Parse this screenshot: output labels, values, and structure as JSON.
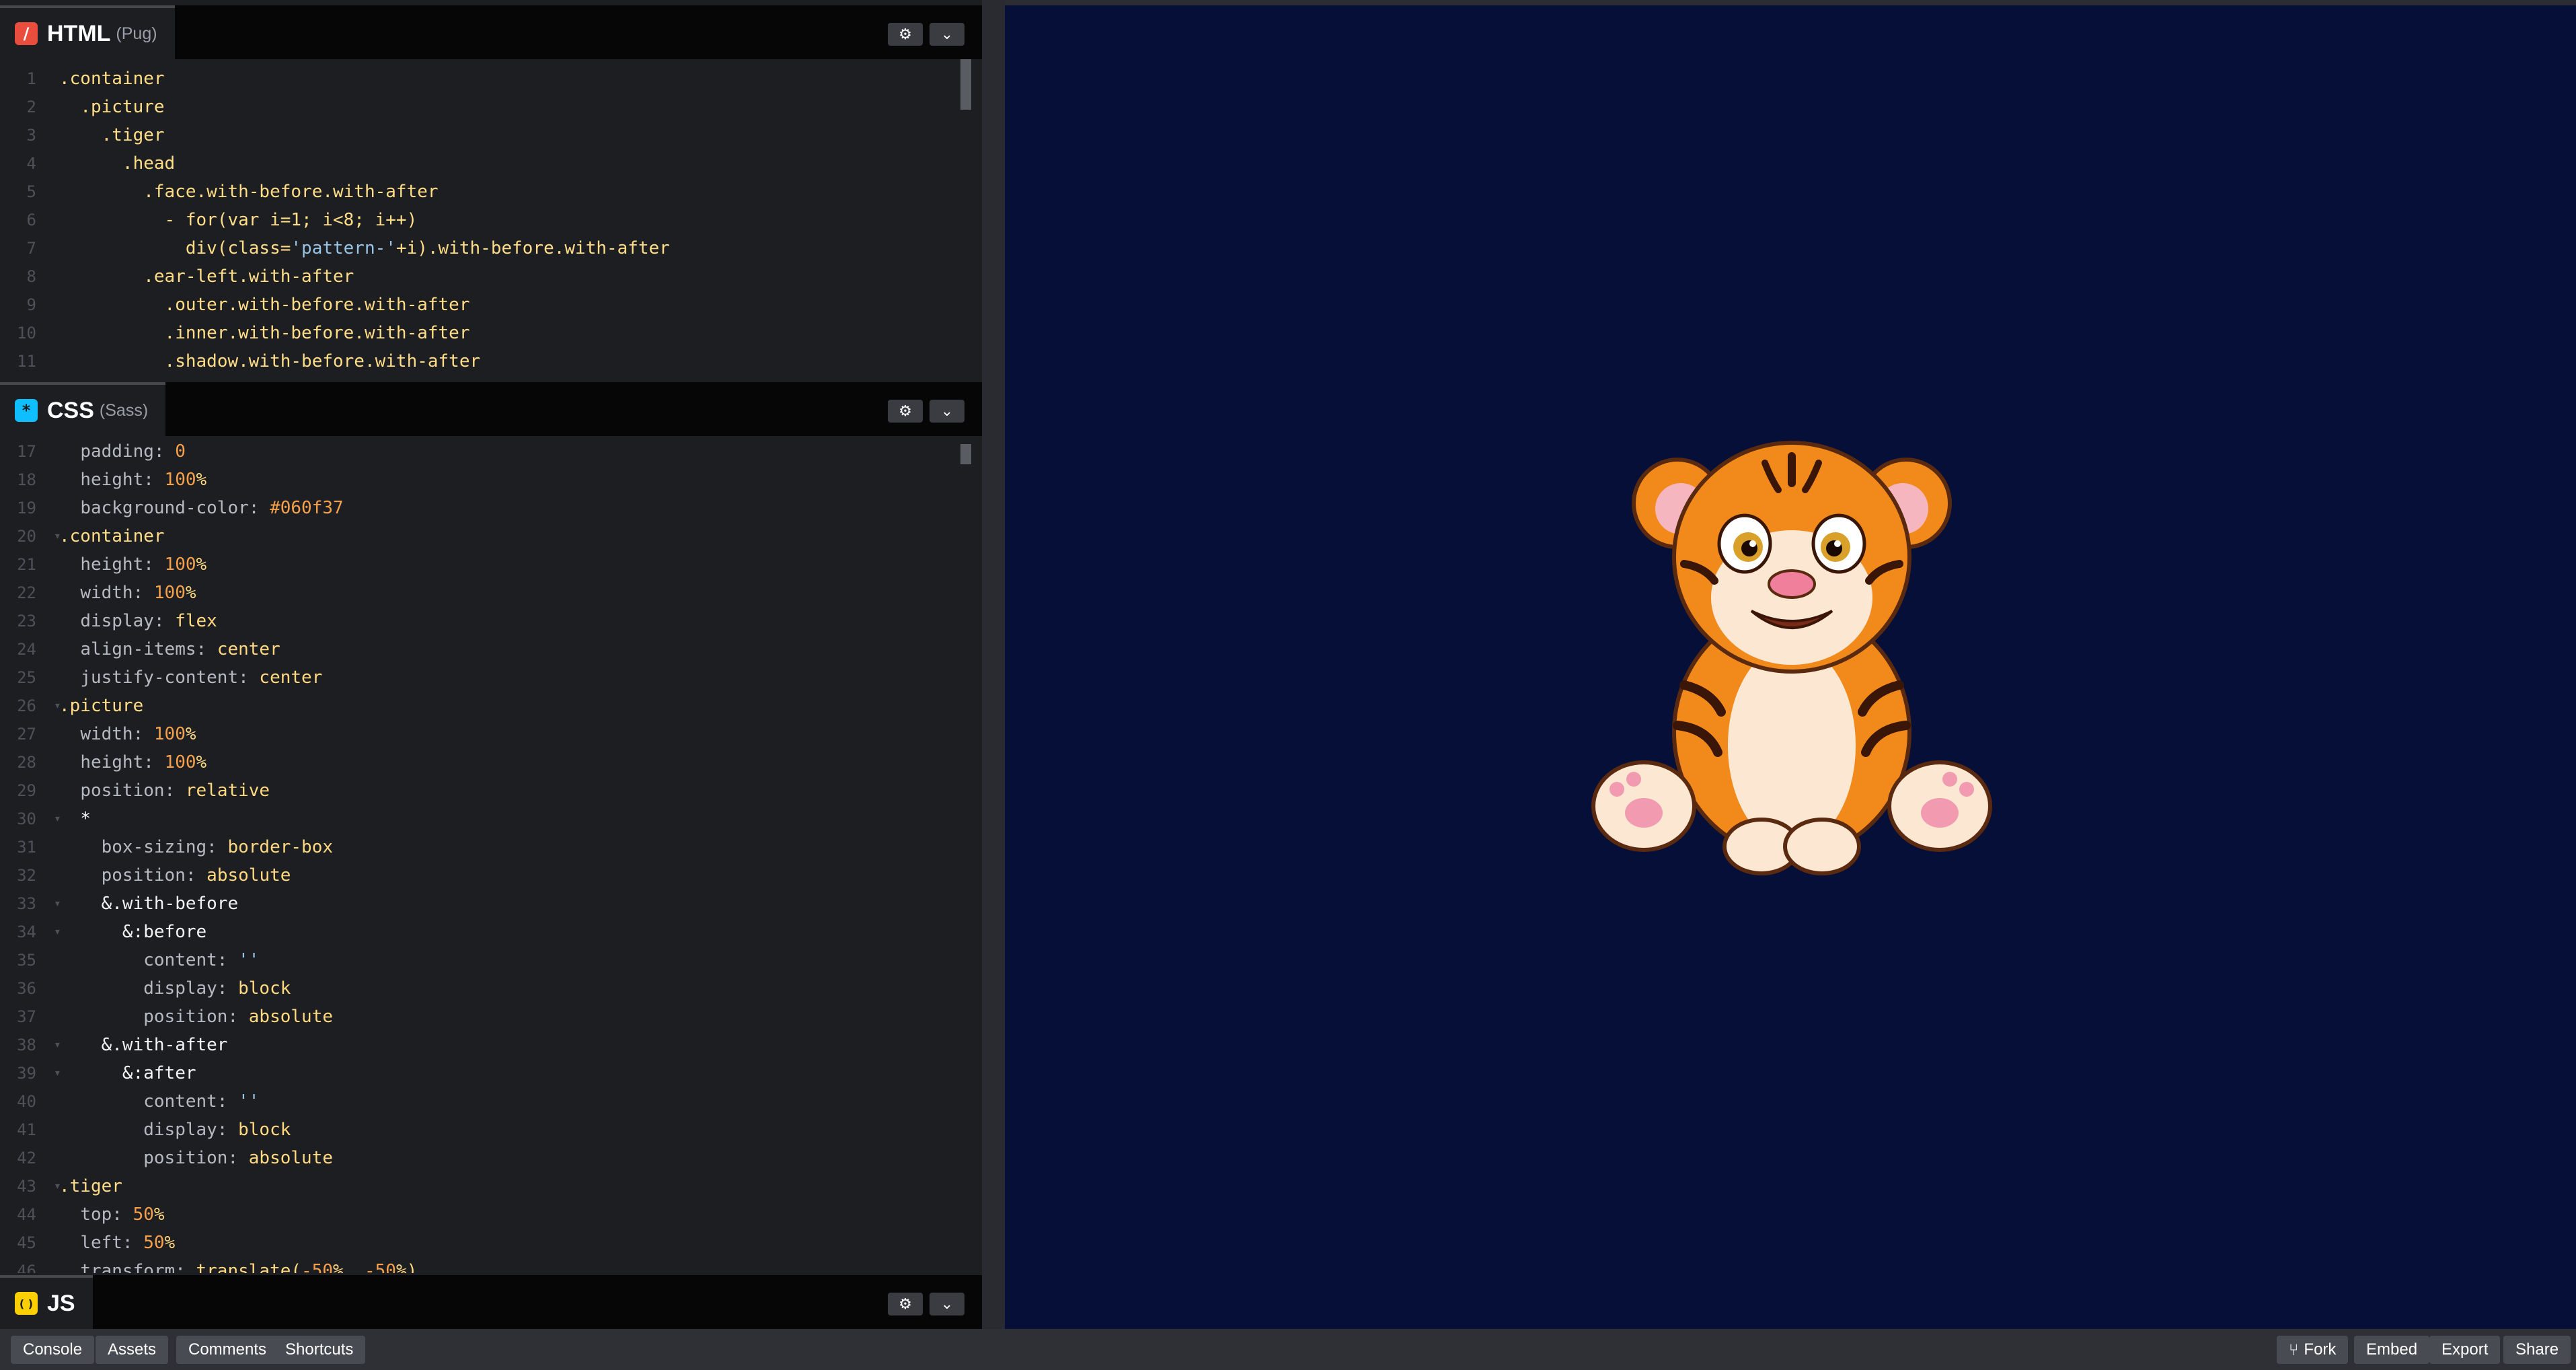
{
  "html_panel": {
    "lang": "HTML",
    "preprocessor": "(Pug)",
    "icon_glyph": "/",
    "icon_color": "#e84d3d",
    "lines": [
      {
        "n": "1",
        "parts": [
          [
            "sel",
            ".container"
          ]
        ]
      },
      {
        "n": "2",
        "parts": [
          [
            "txt",
            "  "
          ],
          [
            "sel",
            ".picture"
          ]
        ]
      },
      {
        "n": "3",
        "parts": [
          [
            "txt",
            "    "
          ],
          [
            "sel",
            ".tiger"
          ]
        ]
      },
      {
        "n": "4",
        "parts": [
          [
            "txt",
            "      "
          ],
          [
            "sel",
            ".head"
          ]
        ]
      },
      {
        "n": "5",
        "parts": [
          [
            "txt",
            "        "
          ],
          [
            "sel",
            ".face.with-before.with-after"
          ]
        ]
      },
      {
        "n": "6",
        "parts": [
          [
            "txt",
            "          "
          ],
          [
            "sel",
            "- for(var i=1; i<8; i++)"
          ]
        ]
      },
      {
        "n": "7",
        "parts": [
          [
            "txt",
            "            "
          ],
          [
            "sel",
            "div("
          ],
          [
            "sel",
            "class="
          ],
          [
            "str",
            "'pattern-'"
          ],
          [
            "sel",
            "+i).with-before.with-after"
          ]
        ]
      },
      {
        "n": "8",
        "parts": [
          [
            "txt",
            "        "
          ],
          [
            "sel",
            ".ear-left.with-after"
          ]
        ]
      },
      {
        "n": "9",
        "parts": [
          [
            "txt",
            "          "
          ],
          [
            "sel",
            ".outer.with-before.with-after"
          ]
        ]
      },
      {
        "n": "10",
        "parts": [
          [
            "txt",
            "          "
          ],
          [
            "sel",
            ".inner.with-before.with-after"
          ]
        ]
      },
      {
        "n": "11",
        "parts": [
          [
            "txt",
            "          "
          ],
          [
            "sel",
            ".shadow.with-before.with-after"
          ]
        ]
      }
    ]
  },
  "css_panel": {
    "lang": "CSS",
    "preprocessor": "(Sass)",
    "icon_glyph": "*",
    "icon_color": "#0ebeff",
    "lines": [
      {
        "n": "17",
        "parts": [
          [
            "txt",
            "  "
          ],
          [
            "prop",
            "padding: "
          ],
          [
            "num",
            "0"
          ]
        ]
      },
      {
        "n": "18",
        "parts": [
          [
            "txt",
            "  "
          ],
          [
            "prop",
            "height: "
          ],
          [
            "num",
            "100"
          ],
          [
            "val",
            "%"
          ]
        ]
      },
      {
        "n": "19",
        "parts": [
          [
            "txt",
            "  "
          ],
          [
            "prop",
            "background-color: "
          ],
          [
            "num",
            "#060f37"
          ]
        ]
      },
      {
        "n": "20",
        "fold": true,
        "parts": [
          [
            "sel",
            ".container"
          ]
        ]
      },
      {
        "n": "21",
        "parts": [
          [
            "txt",
            "  "
          ],
          [
            "prop",
            "height: "
          ],
          [
            "num",
            "100"
          ],
          [
            "val",
            "%"
          ]
        ]
      },
      {
        "n": "22",
        "parts": [
          [
            "txt",
            "  "
          ],
          [
            "prop",
            "width: "
          ],
          [
            "num",
            "100"
          ],
          [
            "val",
            "%"
          ]
        ]
      },
      {
        "n": "23",
        "parts": [
          [
            "txt",
            "  "
          ],
          [
            "prop",
            "display: "
          ],
          [
            "val",
            "flex"
          ]
        ]
      },
      {
        "n": "24",
        "parts": [
          [
            "txt",
            "  "
          ],
          [
            "prop",
            "align-items: "
          ],
          [
            "val",
            "center"
          ]
        ]
      },
      {
        "n": "25",
        "parts": [
          [
            "txt",
            "  "
          ],
          [
            "prop",
            "justify-content: "
          ],
          [
            "val",
            "center"
          ]
        ]
      },
      {
        "n": "26",
        "fold": true,
        "parts": [
          [
            "sel",
            ".picture"
          ]
        ]
      },
      {
        "n": "27",
        "parts": [
          [
            "txt",
            "  "
          ],
          [
            "prop",
            "width: "
          ],
          [
            "num",
            "100"
          ],
          [
            "val",
            "%"
          ]
        ]
      },
      {
        "n": "28",
        "parts": [
          [
            "txt",
            "  "
          ],
          [
            "prop",
            "height: "
          ],
          [
            "num",
            "100"
          ],
          [
            "val",
            "%"
          ]
        ]
      },
      {
        "n": "29",
        "parts": [
          [
            "txt",
            "  "
          ],
          [
            "prop",
            "position: "
          ],
          [
            "val",
            "relative"
          ]
        ]
      },
      {
        "n": "30",
        "fold": true,
        "parts": [
          [
            "txt",
            "  "
          ],
          [
            "kw",
            "*"
          ]
        ]
      },
      {
        "n": "31",
        "parts": [
          [
            "txt",
            "    "
          ],
          [
            "prop",
            "box-sizing: "
          ],
          [
            "val",
            "border-box"
          ]
        ]
      },
      {
        "n": "32",
        "parts": [
          [
            "txt",
            "    "
          ],
          [
            "prop",
            "position: "
          ],
          [
            "val",
            "absolute"
          ]
        ]
      },
      {
        "n": "33",
        "fold": true,
        "parts": [
          [
            "txt",
            "    "
          ],
          [
            "kw",
            "&.with-before"
          ]
        ]
      },
      {
        "n": "34",
        "fold": true,
        "parts": [
          [
            "txt",
            "      "
          ],
          [
            "kw",
            "&:before"
          ]
        ]
      },
      {
        "n": "35",
        "parts": [
          [
            "txt",
            "        "
          ],
          [
            "prop",
            "content: "
          ],
          [
            "str",
            "''"
          ]
        ]
      },
      {
        "n": "36",
        "parts": [
          [
            "txt",
            "        "
          ],
          [
            "prop",
            "display: "
          ],
          [
            "val",
            "block"
          ]
        ]
      },
      {
        "n": "37",
        "parts": [
          [
            "txt",
            "        "
          ],
          [
            "prop",
            "position: "
          ],
          [
            "val",
            "absolute"
          ]
        ]
      },
      {
        "n": "38",
        "fold": true,
        "parts": [
          [
            "txt",
            "    "
          ],
          [
            "kw",
            "&.with-after"
          ]
        ]
      },
      {
        "n": "39",
        "fold": true,
        "parts": [
          [
            "txt",
            "      "
          ],
          [
            "kw",
            "&:after"
          ]
        ]
      },
      {
        "n": "40",
        "parts": [
          [
            "txt",
            "        "
          ],
          [
            "prop",
            "content: "
          ],
          [
            "str",
            "''"
          ]
        ]
      },
      {
        "n": "41",
        "parts": [
          [
            "txt",
            "        "
          ],
          [
            "prop",
            "display: "
          ],
          [
            "val",
            "block"
          ]
        ]
      },
      {
        "n": "42",
        "parts": [
          [
            "txt",
            "        "
          ],
          [
            "prop",
            "position: "
          ],
          [
            "val",
            "absolute"
          ]
        ]
      },
      {
        "n": "43",
        "fold": true,
        "parts": [
          [
            "sel",
            ".tiger"
          ]
        ]
      },
      {
        "n": "44",
        "parts": [
          [
            "txt",
            "  "
          ],
          [
            "prop",
            "top: "
          ],
          [
            "num",
            "50"
          ],
          [
            "val",
            "%"
          ]
        ]
      },
      {
        "n": "45",
        "parts": [
          [
            "txt",
            "  "
          ],
          [
            "prop",
            "left: "
          ],
          [
            "num",
            "50"
          ],
          [
            "val",
            "%"
          ]
        ]
      },
      {
        "n": "46",
        "parts": [
          [
            "txt",
            "  "
          ],
          [
            "prop",
            "transform: "
          ],
          [
            "val",
            "translate("
          ],
          [
            "num",
            "-50"
          ],
          [
            "val",
            "%, "
          ],
          [
            "num",
            "-50"
          ],
          [
            "val",
            "%)"
          ]
        ]
      }
    ]
  },
  "js_panel": {
    "lang": "JS",
    "icon_glyph": "( )",
    "icon_color": "#fcd000"
  },
  "bottom_bar": {
    "left_buttons": [
      "Console",
      "Assets",
      "Comments",
      "Shortcuts"
    ],
    "right_buttons": [
      "Fork",
      "Embed",
      "Export",
      "Share"
    ],
    "fork_icon": "fork-icon"
  },
  "result": {
    "background": "#060f37"
  }
}
